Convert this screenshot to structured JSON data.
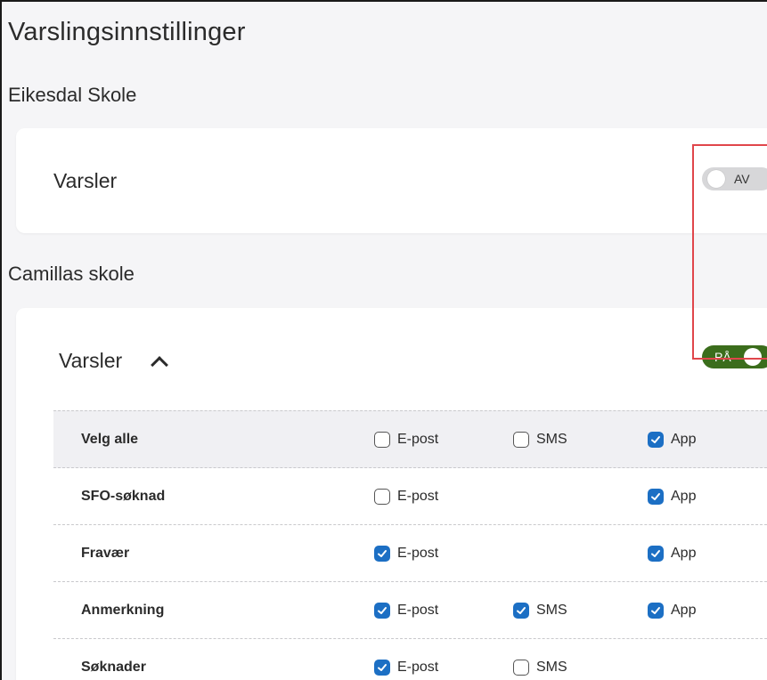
{
  "page": {
    "title": "Varslingsinnstillinger"
  },
  "schools": [
    {
      "name": "Eikesdal Skole",
      "card_label": "Varsler",
      "toggle": {
        "state": "off",
        "label": "AV"
      }
    },
    {
      "name": "Camillas skole",
      "card_label": "Varsler",
      "toggle": {
        "state": "on",
        "label": "PÅ"
      },
      "rows": [
        {
          "label": "Velg alle",
          "epost": {
            "label": "E-post",
            "checked": false
          },
          "sms": {
            "label": "SMS",
            "checked": false
          },
          "app": {
            "label": "App",
            "checked": true
          }
        },
        {
          "label": "SFO-søknad",
          "epost": {
            "label": "E-post",
            "checked": false
          },
          "app": {
            "label": "App",
            "checked": true
          }
        },
        {
          "label": "Fravær",
          "epost": {
            "label": "E-post",
            "checked": true
          },
          "app": {
            "label": "App",
            "checked": true
          }
        },
        {
          "label": "Anmerkning",
          "epost": {
            "label": "E-post",
            "checked": true
          },
          "sms": {
            "label": "SMS",
            "checked": true
          },
          "app": {
            "label": "App",
            "checked": true
          }
        },
        {
          "label": "Søknader",
          "epost": {
            "label": "E-post",
            "checked": true
          },
          "sms": {
            "label": "SMS",
            "checked": false
          }
        }
      ]
    }
  ],
  "colors": {
    "accent": "#1c6fc4",
    "toggle_on": "#3b6d1c",
    "toggle_off": "#d7d7d9",
    "highlight": "#e0464b"
  }
}
